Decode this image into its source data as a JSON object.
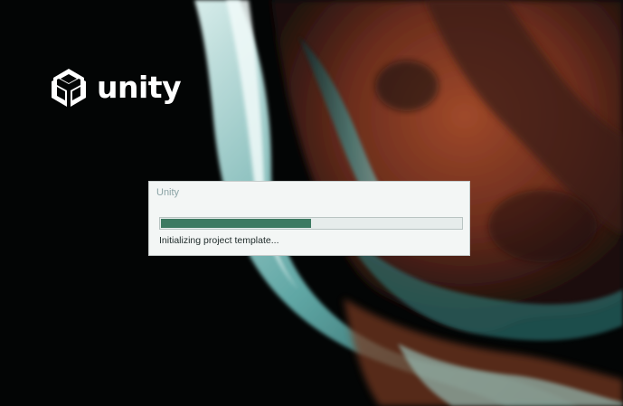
{
  "splash": {
    "brand": "unity",
    "logo_icon": "unity-cube-icon"
  },
  "dialog": {
    "title": "Unity",
    "status": "Initializing project template...",
    "progress": 0.5
  },
  "colors": {
    "background": "#030505",
    "dialog_bg": "#f3f6f5",
    "progress_fill": "#3d7a62",
    "progress_track": "#e6eceb",
    "title_text": "#8aa3a5"
  }
}
